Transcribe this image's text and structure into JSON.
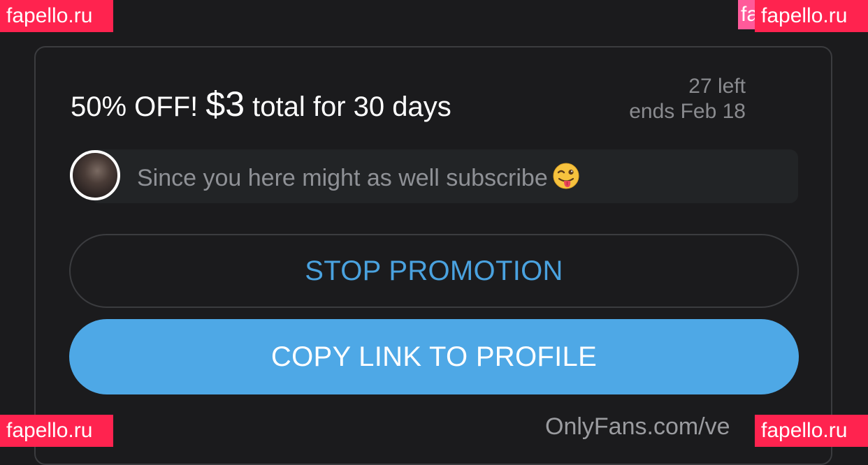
{
  "promo": {
    "prefix": "50% OFF! ",
    "price": "$3",
    "suffix": " total for 30 days",
    "remaining": "27 left",
    "ends": "ends Feb 18"
  },
  "message": {
    "text": "Since you here might as well subscribe",
    "emoji_icon": "winking-face-with-tongue-icon"
  },
  "buttons": {
    "stop_label": "STOP PROMOTION",
    "copy_label": "COPY LINK TO PROFILE"
  },
  "footer": {
    "url_text": "OnlyFans.com/ve"
  },
  "watermarks": {
    "label": "fapello.ru",
    "partial_label": "fa"
  },
  "colors": {
    "background": "#1b1b1d",
    "accent_blue": "#4ea8e6",
    "link_blue": "#4aa2df",
    "watermark_red": "#ff234f"
  }
}
